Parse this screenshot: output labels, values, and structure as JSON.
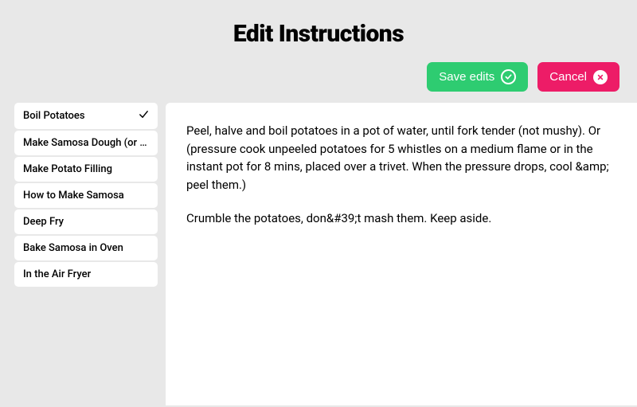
{
  "header": {
    "title": "Edit Instructions"
  },
  "buttons": {
    "save_label": "Save edits",
    "cancel_label": "Cancel"
  },
  "sidebar": {
    "items": [
      {
        "label": "Boil Potatoes",
        "selected": true
      },
      {
        "label": "Make Samosa Dough (or u...",
        "selected": false
      },
      {
        "label": "Make Potato Filling",
        "selected": false
      },
      {
        "label": "How to Make Samosa",
        "selected": false
      },
      {
        "label": "Deep Fry",
        "selected": false
      },
      {
        "label": "Bake Samosa in Oven",
        "selected": false
      },
      {
        "label": "In the Air Fryer",
        "selected": false
      }
    ]
  },
  "content": {
    "paragraphs": [
      "Peel, halve and boil potatoes in a pot of water, until fork tender (not mushy). Or (pressure cook unpeeled potatoes for 5 whistles on a medium flame or in the instant pot for 8 mins, placed over a trivet. When the pressure drops, cool &amp; peel them.)",
      "Crumble the potatoes, don&#39;t mash them. Keep aside."
    ]
  }
}
